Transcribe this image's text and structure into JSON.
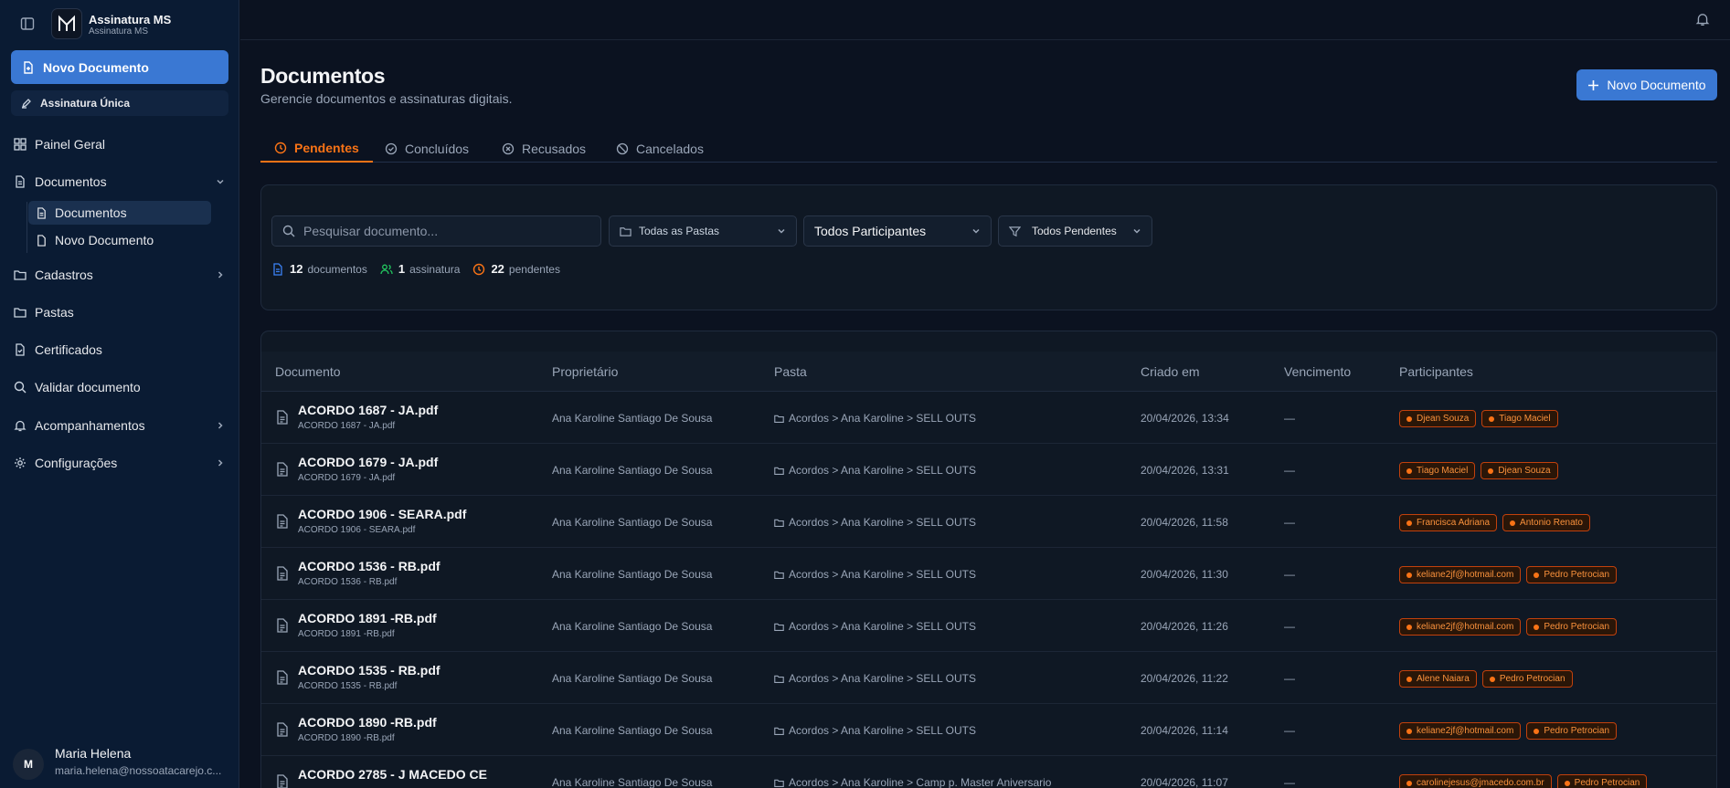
{
  "brand": {
    "title": "Assinatura MS",
    "subtitle": "Assinatura MS"
  },
  "sidebar": {
    "new_doc": "Novo Documento",
    "single_sign": "Assinatura Única",
    "items": [
      {
        "label": "Painel Geral"
      },
      {
        "label": "Documentos"
      },
      {
        "label": "Cadastros"
      },
      {
        "label": "Pastas"
      },
      {
        "label": "Certificados"
      },
      {
        "label": "Validar documento"
      },
      {
        "label": "Acompanhamentos"
      },
      {
        "label": "Configurações"
      }
    ],
    "sub_items": [
      {
        "label": "Documentos"
      },
      {
        "label": "Novo Documento"
      }
    ]
  },
  "user": {
    "initial": "M",
    "name": "Maria Helena",
    "email": "maria.helena@nossoatacarejo.c..."
  },
  "page": {
    "title": "Documentos",
    "subtitle": "Gerencie documentos e assinaturas digitais.",
    "new_doc_button": "Novo Documento"
  },
  "tabs": [
    {
      "label": "Pendentes",
      "active": true
    },
    {
      "label": "Concluídos"
    },
    {
      "label": "Recusados"
    },
    {
      "label": "Cancelados"
    }
  ],
  "filters": {
    "search_placeholder": "Pesquisar documento...",
    "folders": "Todas as Pastas",
    "participants": "Todos Participantes",
    "pending": "Todos Pendentes"
  },
  "stats": {
    "documents_count": "12",
    "documents_label": "documentos",
    "signatures_count": "1",
    "signatures_label": "assinatura",
    "pending_count": "22",
    "pending_label": "pendentes"
  },
  "table": {
    "headers": [
      "Documento",
      "Proprietário",
      "Pasta",
      "Criado em",
      "Vencimento",
      "Participantes"
    ],
    "rows": [
      {
        "name": "ACORDO 1687 - JA.pdf",
        "file": "ACORDO 1687 - JA.pdf",
        "owner": "Ana Karoline Santiago De Sousa",
        "folder": "Acordos > Ana Karoline > SELL OUTS",
        "created": "20/04/2026, 13:34",
        "due": "—",
        "participants": [
          "Djean Souza",
          "Tiago Maciel"
        ]
      },
      {
        "name": "ACORDO 1679 - JA.pdf",
        "file": "ACORDO 1679 - JA.pdf",
        "owner": "Ana Karoline Santiago De Sousa",
        "folder": "Acordos > Ana Karoline > SELL OUTS",
        "created": "20/04/2026, 13:31",
        "due": "—",
        "participants": [
          "Tiago Maciel",
          "Djean Souza"
        ]
      },
      {
        "name": "ACORDO 1906 - SEARA.pdf",
        "file": "ACORDO 1906 - SEARA.pdf",
        "owner": "Ana Karoline Santiago De Sousa",
        "folder": "Acordos > Ana Karoline > SELL OUTS",
        "created": "20/04/2026, 11:58",
        "due": "—",
        "participants": [
          "Francisca Adriana",
          "Antonio Renato"
        ]
      },
      {
        "name": "ACORDO 1536 - RB.pdf",
        "file": "ACORDO 1536 - RB.pdf",
        "owner": "Ana Karoline Santiago De Sousa",
        "folder": "Acordos > Ana Karoline > SELL OUTS",
        "created": "20/04/2026, 11:30",
        "due": "—",
        "participants": [
          "keliane2jf@hotmail.com",
          "Pedro Petrocian"
        ]
      },
      {
        "name": "ACORDO 1891 -RB.pdf",
        "file": "ACORDO 1891 -RB.pdf",
        "owner": "Ana Karoline Santiago De Sousa",
        "folder": "Acordos > Ana Karoline > SELL OUTS",
        "created": "20/04/2026, 11:26",
        "due": "—",
        "participants": [
          "keliane2jf@hotmail.com",
          "Pedro Petrocian"
        ]
      },
      {
        "name": "ACORDO 1535 - RB.pdf",
        "file": "ACORDO 1535 - RB.pdf",
        "owner": "Ana Karoline Santiago De Sousa",
        "folder": "Acordos > Ana Karoline > SELL OUTS",
        "created": "20/04/2026, 11:22",
        "due": "—",
        "participants": [
          "Alene Naiara",
          "Pedro Petrocian"
        ]
      },
      {
        "name": "ACORDO 1890 -RB.pdf",
        "file": "ACORDO 1890 -RB.pdf",
        "owner": "Ana Karoline Santiago De Sousa",
        "folder": "Acordos > Ana Karoline > SELL OUTS",
        "created": "20/04/2026, 11:14",
        "due": "—",
        "participants": [
          "keliane2jf@hotmail.com",
          "Pedro Petrocian"
        ]
      },
      {
        "name": "ACORDO 2785 - J MACEDO CE",
        "file": "",
        "owner": "Ana Karoline Santiago De Sousa",
        "folder": "Acordos > Ana Karoline > Camp p. Master Aniversario",
        "created": "20/04/2026, 11:07",
        "due": "—",
        "participants": [
          "carolinejesus@jmacedo.com.br",
          "Pedro Petrocian"
        ]
      }
    ]
  },
  "colors": {
    "accent": "#3a78d3",
    "active_tab": "#f97316",
    "badge": "#fb923c",
    "sidebar_bg": "#0a1b33",
    "page_bg": "#0b1220"
  }
}
